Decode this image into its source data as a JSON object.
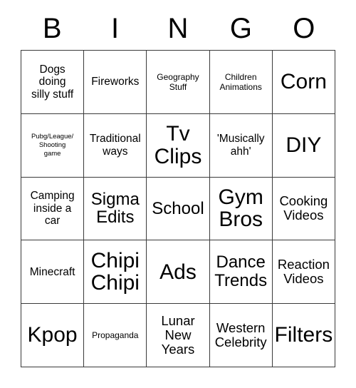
{
  "card": {
    "headers": [
      "B",
      "I",
      "N",
      "G",
      "O"
    ],
    "rows": [
      [
        {
          "text": "Dogs\ndoing\nsilly stuff",
          "size": "md"
        },
        {
          "text": "Fireworks",
          "size": "md"
        },
        {
          "text": "Geography\nStuff",
          "size": "sm"
        },
        {
          "text": "Children\nAnimations",
          "size": "sm"
        },
        {
          "text": "Corn",
          "size": "xxl"
        }
      ],
      [
        {
          "text": "Pubg/League/\nShooting\ngame",
          "size": "xs"
        },
        {
          "text": "Traditional\nways",
          "size": "md"
        },
        {
          "text": "Tv\nClips",
          "size": "xxl"
        },
        {
          "text": "'Musically\nahh'",
          "size": "md"
        },
        {
          "text": "DIY",
          "size": "xxl"
        }
      ],
      [
        {
          "text": "Camping\ninside a\ncar",
          "size": "md"
        },
        {
          "text": "Sigma\nEdits",
          "size": "xl"
        },
        {
          "text": "School",
          "size": "xl"
        },
        {
          "text": "Gym\nBros",
          "size": "xxl"
        },
        {
          "text": "Cooking\nVideos",
          "size": "lg"
        }
      ],
      [
        {
          "text": "Minecraft",
          "size": "md"
        },
        {
          "text": "Chipi\nChipi",
          "size": "xxl"
        },
        {
          "text": "Ads",
          "size": "xxl"
        },
        {
          "text": "Dance\nTrends",
          "size": "xl"
        },
        {
          "text": "Reaction\nVideos",
          "size": "lg"
        }
      ],
      [
        {
          "text": "Kpop",
          "size": "xxl"
        },
        {
          "text": "Propaganda",
          "size": "sm"
        },
        {
          "text": "Lunar\nNew\nYears",
          "size": "lg"
        },
        {
          "text": "Western\nCelebrity",
          "size": "lg"
        },
        {
          "text": "Filters",
          "size": "xxl"
        }
      ]
    ]
  },
  "colors": {
    "border": "#3a3a3a",
    "text": "#000000",
    "background": "#ffffff"
  }
}
